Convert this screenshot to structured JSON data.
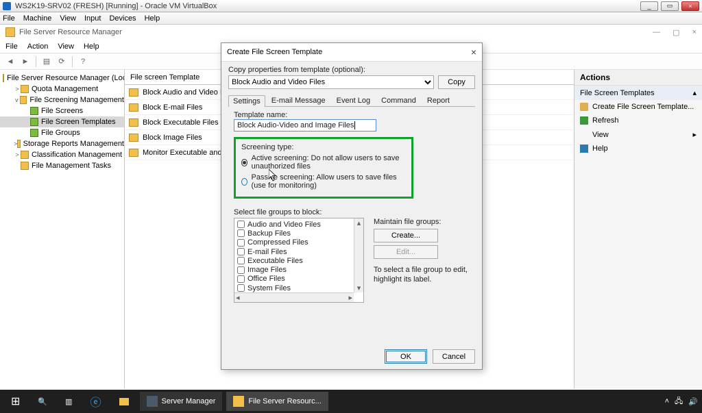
{
  "vbox": {
    "title": "WS2K19-SRV02 (FRESH) [Running] - Oracle VM VirtualBox",
    "menu": [
      "File",
      "Machine",
      "View",
      "Input",
      "Devices",
      "Help"
    ]
  },
  "inner": {
    "title": "File Server Resource Manager",
    "menu": [
      "File",
      "Action",
      "View",
      "Help"
    ]
  },
  "tree": {
    "root": "File Server Resource Manager (Local)",
    "items": [
      {
        "indent": 1,
        "caret": ">",
        "label": "Quota Management"
      },
      {
        "indent": 1,
        "caret": "v",
        "label": "File Screening Management"
      },
      {
        "indent": 2,
        "caret": "",
        "label": "File Screens"
      },
      {
        "indent": 2,
        "caret": "",
        "label": "File Screen Templates",
        "selected": true
      },
      {
        "indent": 2,
        "caret": "",
        "label": "File Groups"
      },
      {
        "indent": 1,
        "caret": ">",
        "label": "Storage Reports Management"
      },
      {
        "indent": 1,
        "caret": ">",
        "label": "Classification Management"
      },
      {
        "indent": 1,
        "caret": "",
        "label": "File Management Tasks"
      }
    ]
  },
  "list": {
    "header": "File screen Template",
    "rows": [
      "Block Audio and Video Files",
      "Block E-mail Files",
      "Block Executable Files",
      "Block Image Files",
      "Monitor Executable and System Files"
    ]
  },
  "actions": {
    "header": "Actions",
    "section": "File Screen Templates",
    "items": [
      {
        "label": "Create File Screen Template...",
        "icon": "#e0b050"
      },
      {
        "label": "Refresh",
        "icon": "#3a9a3a"
      },
      {
        "label": "View",
        "icon": "",
        "arrow": true
      },
      {
        "label": "Help",
        "icon": "#2a7ab0"
      }
    ]
  },
  "dialog": {
    "title": "Create File Screen Template",
    "copy_label": "Copy properties from template (optional):",
    "copy_value": "Block Audio and Video Files",
    "copy_btn": "Copy",
    "tabs": [
      "Settings",
      "E-mail Message",
      "Event Log",
      "Command",
      "Report"
    ],
    "name_label": "Template name:",
    "name_value": "Block Audio-Video and Image Files",
    "screen_label": "Screening type:",
    "radio_active": "Active screening: Do not allow users to save unauthorized files",
    "radio_passive": "Passive screening: Allow users to save files (use for monitoring)",
    "select_label": "Select file groups to block:",
    "file_groups": [
      "Audio and Video Files",
      "Backup Files",
      "Compressed Files",
      "E-mail Files",
      "Executable Files",
      "Image Files",
      "Office Files",
      "System Files"
    ],
    "maintain_label": "Maintain file groups:",
    "create_btn": "Create...",
    "edit_btn": "Edit...",
    "hint": "To select a file group to edit, highlight its label.",
    "ok": "OK",
    "cancel": "Cancel"
  },
  "taskbar": {
    "items": [
      {
        "label": "Server Manager"
      },
      {
        "label": "File Server Resourc..."
      }
    ]
  }
}
